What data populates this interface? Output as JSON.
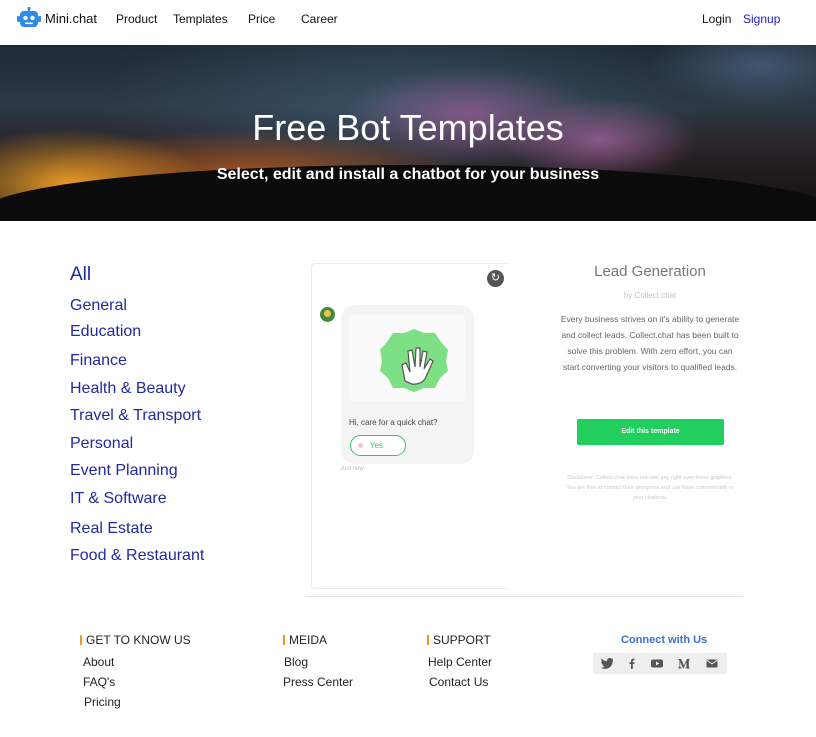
{
  "nav": {
    "logo_text": "Mini.chat",
    "links": [
      "Product",
      "Templates",
      "Price",
      "Career"
    ],
    "login": "Login",
    "signup": "Signup"
  },
  "hero": {
    "title": "Free Bot Templates",
    "subtitle": "Select, edit and install a chatbot for your business"
  },
  "categories": {
    "all": "All",
    "items": [
      "General",
      "Education",
      "Finance",
      "Health & Beauty",
      "Travel & Transport",
      "Personal",
      "Event Planning",
      "IT & Software",
      "Real Estate",
      "Food & Restaurant"
    ]
  },
  "preview": {
    "message": "Hi, care for a quick chat?",
    "yes_label": "Yes",
    "timestamp": "Just now"
  },
  "template": {
    "title": "Lead Generation",
    "by": "by Collect.chat",
    "description": "Every business strives on it's ability to generate and collect leads. Collect.chat has been built to solve this problem. With zero effort, you can start converting your visitors to qualified leads.",
    "button": "Edit this template",
    "disclaimer": "Disclaimer: Collect.chat does not own any right over these graphics. You are free to contact their designers and use them commercially in your chatbots."
  },
  "footer": {
    "col1": {
      "heading": "GET TO KNOW US",
      "links": [
        "About",
        "FAQ's",
        "Pricing"
      ]
    },
    "col2": {
      "heading": "MEIDA",
      "links": [
        "Blog",
        "Press Center"
      ]
    },
    "col3": {
      "heading": "SUPPORT",
      "links": [
        "Help Center",
        "Contact Us"
      ]
    },
    "connect": "Connect with Us",
    "social_icons": [
      "twitter-icon",
      "facebook-icon",
      "youtube-icon",
      "medium-icon",
      "email-icon"
    ]
  },
  "colors": {
    "link_blue": "#1f2aa0",
    "signup_blue": "#1a22c8",
    "accent_green": "#20cf5d",
    "footer_accent": "#f29a1e",
    "connect_blue": "#3a6fd8"
  }
}
